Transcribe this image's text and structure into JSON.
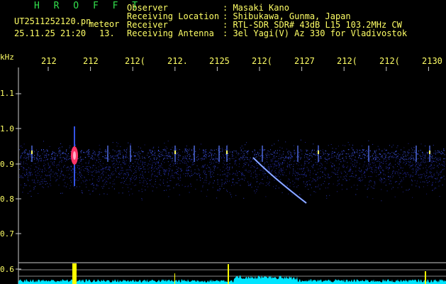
{
  "header": {
    "station": "H R O F F T",
    "filename": "UT2511252120.pn",
    "mode": "meteor",
    "datetime": "25.11.25 21:20",
    "count": "13."
  },
  "info": {
    "observer_label": "Observer",
    "observer_value": ": Masaki Kano",
    "location_label": "Receiving Location",
    "location_value": ": Shibukawa, Gunma, Japan",
    "receiver_label": "Receiver",
    "receiver_value": ": RTL-SDR SDR# 43dB L15 103.2MHz CW",
    "antenna_label": "Receiving Antenna",
    "antenna_value": ": 3el Yagi(V) Az 330 for Vladivostok"
  },
  "axes": {
    "y_unit": "kHz",
    "y_ticks": [
      "1.1",
      "1.0",
      "0.9",
      "0.8",
      "0.7",
      "0.6"
    ],
    "x_ticks": [
      "212",
      "212",
      "212(",
      "212.",
      "2125",
      "212(",
      "2127",
      "212(",
      "212(",
      "2130"
    ]
  },
  "colors": {
    "text": "#ffff66",
    "station": "#33e04c",
    "grid": "#cccccc",
    "signal": "#3a5cff",
    "meteor": "#ff3366",
    "spectrum": "#00e5ff",
    "peak": "#ffff00"
  }
}
